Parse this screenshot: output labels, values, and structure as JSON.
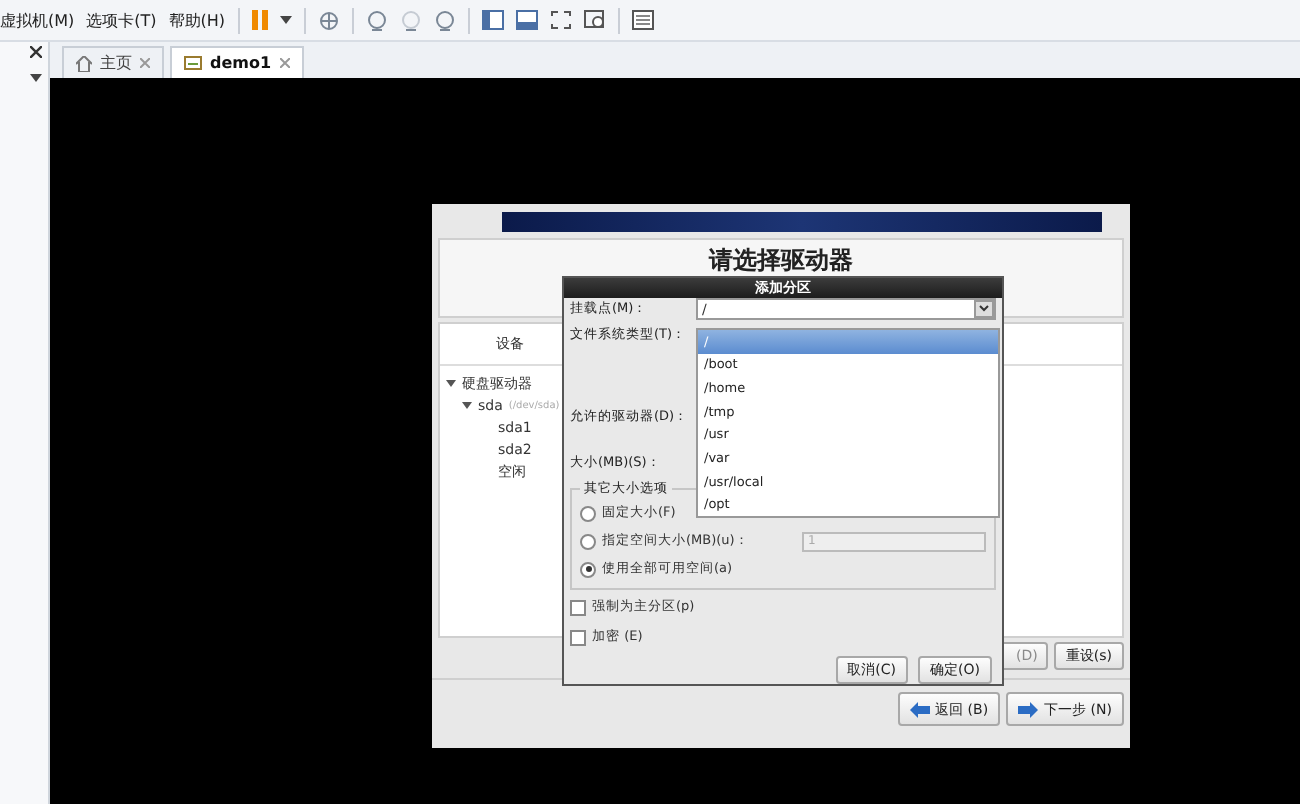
{
  "menu": [
    "虚拟机(M)",
    "选项卡(T)",
    "帮助(H)"
  ],
  "tabs": [
    {
      "label": "主页",
      "selected": false,
      "kind": "home"
    },
    {
      "label": "demo1",
      "selected": true,
      "kind": "vm"
    }
  ],
  "installer": {
    "heading": "请选择驱动器",
    "column": "设备",
    "tree": [
      {
        "label": "硬盘驱动器",
        "expanded": true,
        "children": [
          {
            "label": "sda",
            "note": "(/dev/sda)",
            "expanded": true,
            "children": [
              {
                "label": "sda1"
              },
              {
                "label": "sda2"
              },
              {
                "label": "空闲"
              }
            ]
          }
        ]
      }
    ],
    "buttons": [
      {
        "label": "(D)",
        "disabled": true
      },
      {
        "label": "重设(s)",
        "disabled": false
      }
    ],
    "nav": [
      {
        "label": "返回 (B)",
        "kind": "back"
      },
      {
        "label": "下一步 (N)",
        "kind": "next"
      }
    ]
  },
  "dialog": {
    "title": "添加分区",
    "mount_label": "挂载点(M)：",
    "mount_value": "/",
    "mount_options": [
      {
        "label": "/",
        "selected": true
      },
      {
        "label": "/boot",
        "selected": false
      },
      {
        "label": "/home",
        "selected": false
      },
      {
        "label": "/tmp",
        "selected": false
      },
      {
        "label": "/usr",
        "selected": false
      },
      {
        "label": "/var",
        "selected": false
      },
      {
        "label": "/usr/local",
        "selected": false
      },
      {
        "label": "/opt",
        "selected": false
      }
    ],
    "labels": [
      "文件系统类型(T)：",
      "允许的驱动器(D)：",
      "大小(MB)(S)："
    ],
    "size_group": "其它大小选项",
    "size_options": [
      {
        "label": "固定大小(F)",
        "selected": false
      },
      {
        "label": "指定空间大小(MB)(u)：",
        "selected": false,
        "value": "1"
      },
      {
        "label": "使用全部可用空间(a)",
        "selected": true
      }
    ],
    "checks": [
      {
        "label": "强制为主分区(p)",
        "checked": false
      },
      {
        "label": "加密 (E)",
        "checked": false
      }
    ],
    "buttons": [
      "取消(C)",
      "确定(O)"
    ]
  }
}
